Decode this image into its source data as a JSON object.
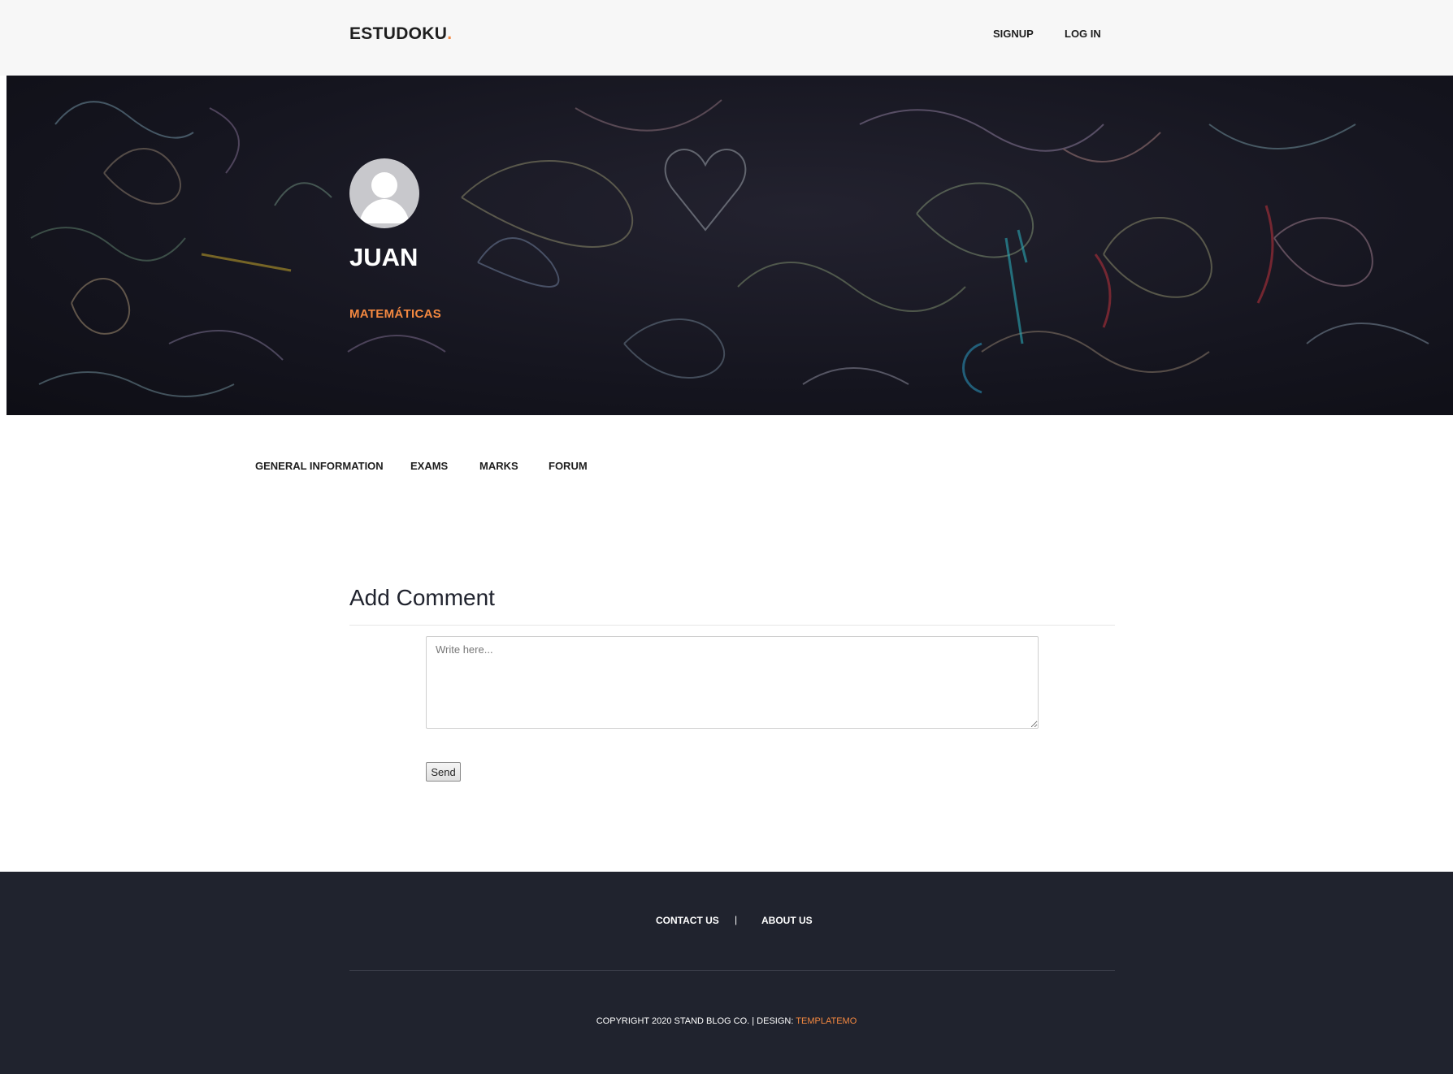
{
  "header": {
    "logo_text": "ESTUDOKU",
    "logo_dot": ".",
    "nav": {
      "signup": "SIGNUP",
      "login": "LOG IN"
    }
  },
  "hero": {
    "name": "JUAN",
    "subject": "MATEMÁTICAS",
    "avatar_icon": "user-avatar-icon"
  },
  "tabs": [
    {
      "label": "GENERAL INFORMATION"
    },
    {
      "label": "EXAMS"
    },
    {
      "label": "MARKS"
    },
    {
      "label": "FORUM"
    }
  ],
  "comment": {
    "title": "Add Comment",
    "placeholder": "Write here...",
    "value": "",
    "send_label": "Send"
  },
  "footer": {
    "links": {
      "contact": "CONTACT US",
      "about": "ABOUT US"
    },
    "separator": "|",
    "copyright_prefix": "COPYRIGHT 2020 STAND BLOG CO. | DESIGN: ",
    "copyright_link": "TEMPLATEMO"
  },
  "colors": {
    "accent": "#f48840",
    "footer_bg": "#20232e",
    "header_bg": "#f7f7f7",
    "text_dark": "#1e1e1e"
  }
}
